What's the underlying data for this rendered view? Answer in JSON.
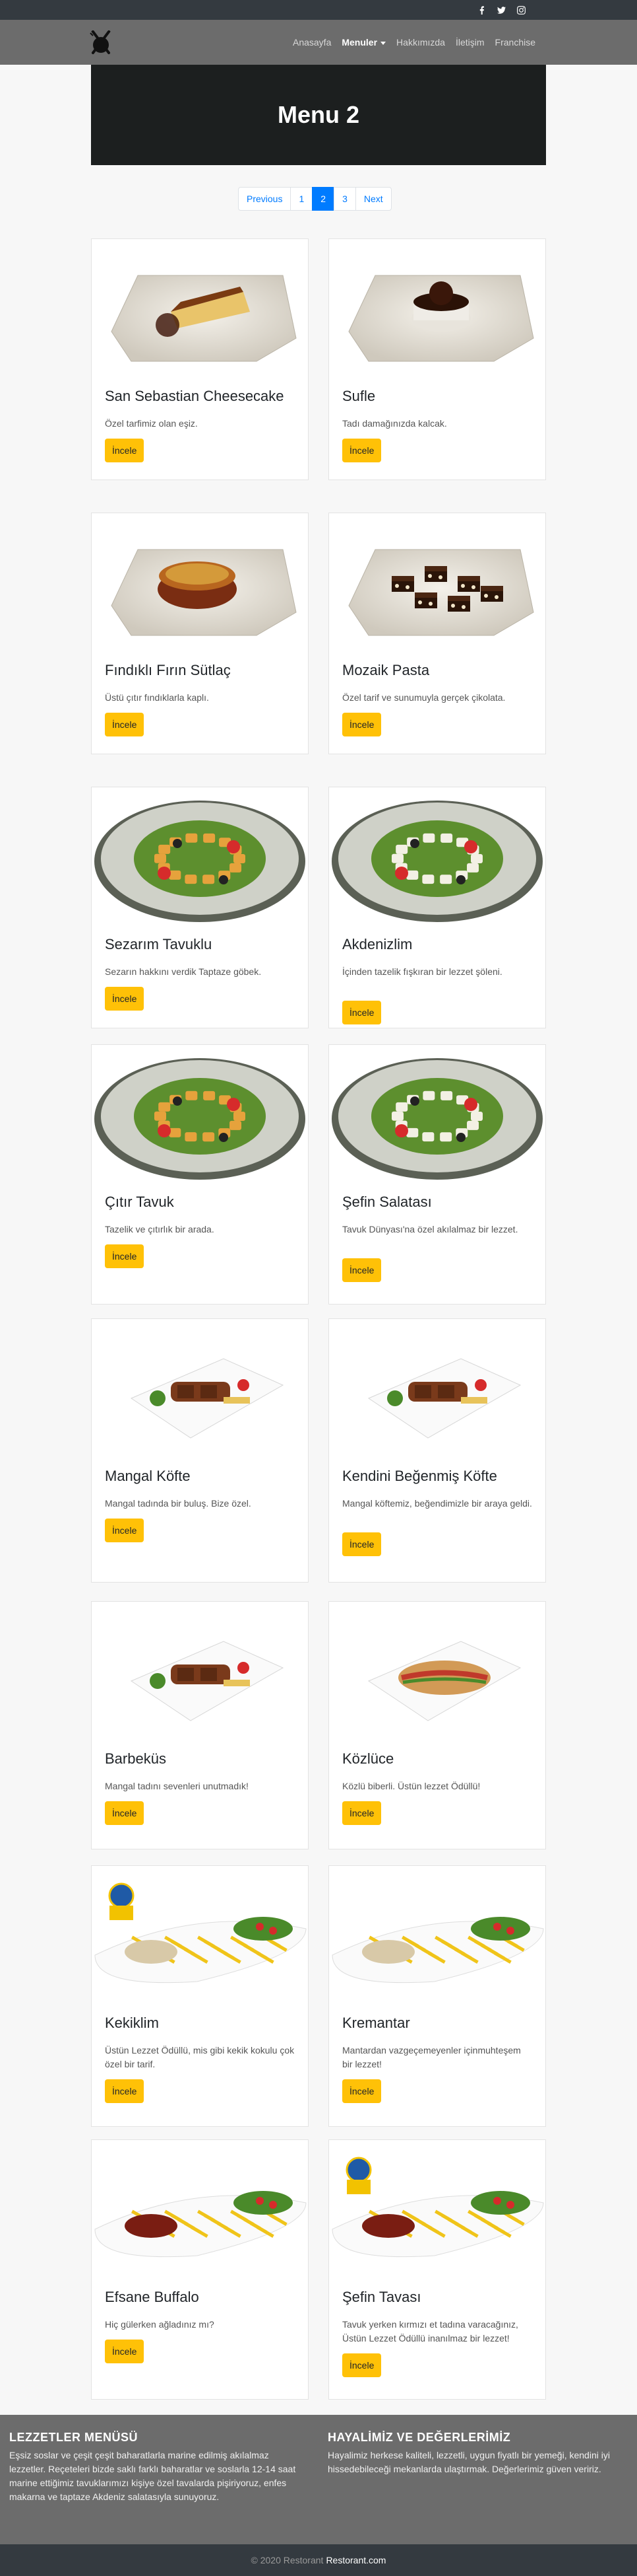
{
  "social": {
    "icons": [
      "facebook-icon",
      "twitter-icon",
      "instagram-icon"
    ]
  },
  "nav": {
    "items": [
      "Anasayfa",
      "Menuler",
      "Hakkımızda",
      "İletişim",
      "Franchise"
    ],
    "active": "Menuler"
  },
  "hero": {
    "title": "Menu 2"
  },
  "pagination": {
    "previous": "Previous",
    "pages": [
      "1",
      "2",
      "3"
    ],
    "current": "2",
    "next": "Next"
  },
  "cards": [
    {
      "title": "San Sebastian Cheesecake",
      "desc": "Özel tarfimiz olan eşiz.",
      "button": "İncele",
      "dish": "cheesecake"
    },
    {
      "title": "Sufle",
      "desc": "Tadı damağınızda kalcak.",
      "button": "İncele",
      "dish": "sufle"
    },
    {
      "title": "Fındıklı Fırın Sütlaç",
      "desc": "Üstü çıtır fındıklarla kaplı.",
      "button": "İncele",
      "dish": "sutlac"
    },
    {
      "title": "Mozaik Pasta",
      "desc": "Özel tarif ve sunumuyla gerçek çikolata.",
      "button": "İncele",
      "dish": "mozaik"
    },
    {
      "title": "Sezarım Tavuklu",
      "desc": "Sezarın hakkını verdik Taptaze göbek.",
      "button": "İncele",
      "dish": "salad"
    },
    {
      "title": "Akdenizlim",
      "desc": "İçinden tazelik fışkıran bir lezzet şöleni.",
      "button": "İncele",
      "dish": "salad2"
    },
    {
      "title": "Çıtır Tavuk",
      "desc": "Tazelik ve çıtırlık bir arada.",
      "button": "İncele",
      "dish": "salad"
    },
    {
      "title": "Şefin Salatası",
      "desc": "Tavuk Dünyası'na özel akılalmaz bir lezzet.",
      "button": "İncele",
      "dish": "salad2"
    },
    {
      "title": "Mangal Köfte",
      "desc": "Mangal tadında bir buluş. Bize özel.",
      "button": "İncele",
      "dish": "kofte"
    },
    {
      "title": "Kendini Beğenmiş Köfte",
      "desc": "Mangal köftemiz, beğendimizle bir araya geldi.",
      "button": "İncele",
      "dish": "kofte2"
    },
    {
      "title": "Barbeküs",
      "desc": "Mangal tadını sevenleri unutmadık!",
      "button": "İncele",
      "dish": "kofte2"
    },
    {
      "title": "Közlüce",
      "desc": "Közlü biberli. Üstün lezzet Ödüllü!",
      "button": "İncele",
      "dish": "sandwich"
    },
    {
      "title": "Kekiklim",
      "desc": "Üstün Lezzet Ödüllü, mis gibi kekik kokulu çok özel bir tarif.",
      "button": "İncele",
      "dish": "platter",
      "badge": true
    },
    {
      "title": "Kremantar",
      "desc": "Mantardan vazgeçemeyenler içinmuhteşem bir lezzet!",
      "button": "İncele",
      "dish": "platter"
    },
    {
      "title": "Efsane Buffalo",
      "desc": "Hiç gülerken ağladınız mı?",
      "button": "İncele",
      "dish": "platter2"
    },
    {
      "title": "Şefin Tavası",
      "desc": "Tavuk yerken kırmızı et tadına varacağınız, Üstün Lezzet Ödüllü inanılmaz bir lezzet!",
      "button": "İncele",
      "dish": "platter2",
      "badge": true
    }
  ],
  "footer": {
    "left_title": "LEZZETLER MENÜSÜ",
    "left_text": "Eşsiz soslar ve çeşit çeşit baharatlarla marine edilmiş akılalmaz lezzetler. Reçeteleri bizde saklı farklı baharatlar ve soslarla 12-14 saat marine ettiğimiz tavuklarımızı kişiye özel tavalarda pişiriyoruz, enfes makarna ve taptaze Akdeniz salatasıyla sunuyoruz.",
    "right_title": "HAYALİMİZ VE DEĞERLERİMİZ",
    "right_text": "Hayalimiz herkese kaliteli, lezzetli, uygun fiyatlı bir yemeği, kendini iyi hissedebileceği mekanlarda ulaştırmak. Değerlerimiz güven veririz."
  },
  "copyright": {
    "text": "© 2020 Restorant",
    "link": "Restorant.com"
  }
}
